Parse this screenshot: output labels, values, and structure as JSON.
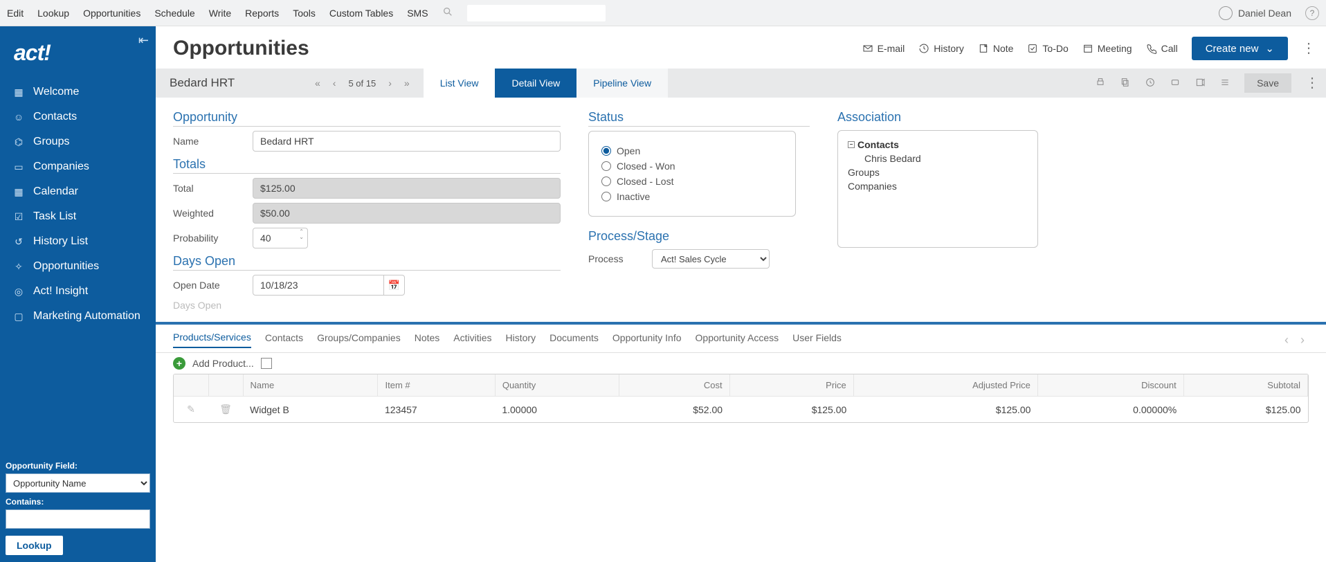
{
  "topmenu": {
    "items": [
      "Edit",
      "Lookup",
      "Opportunities",
      "Schedule",
      "Write",
      "Reports",
      "Tools",
      "Custom Tables",
      "SMS"
    ]
  },
  "user": {
    "name": "Daniel Dean"
  },
  "logo": "act!",
  "sidebar": {
    "items": [
      {
        "label": "Welcome",
        "icon": "grid"
      },
      {
        "label": "Contacts",
        "icon": "person"
      },
      {
        "label": "Groups",
        "icon": "people"
      },
      {
        "label": "Companies",
        "icon": "briefcase"
      },
      {
        "label": "Calendar",
        "icon": "calendar"
      },
      {
        "label": "Task List",
        "icon": "check"
      },
      {
        "label": "History List",
        "icon": "history"
      },
      {
        "label": "Opportunities",
        "icon": "diamond"
      },
      {
        "label": "Act! Insight",
        "icon": "eye"
      },
      {
        "label": "Marketing Automation",
        "icon": "monitor"
      }
    ],
    "field_label": "Opportunity Field:",
    "field_value": "Opportunity Name",
    "contains_label": "Contains:",
    "contains_value": "",
    "lookup_btn": "Lookup"
  },
  "page": {
    "title": "Opportunities",
    "actions": [
      {
        "label": "E-mail",
        "icon": "mail"
      },
      {
        "label": "History",
        "icon": "history"
      },
      {
        "label": "Note",
        "icon": "note"
      },
      {
        "label": "To-Do",
        "icon": "check"
      },
      {
        "label": "Meeting",
        "icon": "calendar"
      },
      {
        "label": "Call",
        "icon": "phone"
      }
    ],
    "create_btn": "Create new"
  },
  "viewbar": {
    "record": "Bedard HRT",
    "counter": "5 of 15",
    "tabs": [
      {
        "label": "List View"
      },
      {
        "label": "Detail View",
        "active": true
      },
      {
        "label": "Pipeline View"
      }
    ],
    "save": "Save"
  },
  "detail": {
    "opportunity_title": "Opportunity",
    "name_label": "Name",
    "name_value": "Bedard HRT",
    "totals_title": "Totals",
    "total_label": "Total",
    "total_value": "$125.00",
    "weighted_label": "Weighted",
    "weighted_value": "$50.00",
    "prob_label": "Probability",
    "prob_value": "40",
    "days_title": "Days Open",
    "open_label": "Open Date",
    "open_value": "10/18/23",
    "daysopen_label": "Days Open",
    "status_title": "Status",
    "status_options": [
      "Open",
      "Closed - Won",
      "Closed - Lost",
      "Inactive"
    ],
    "status_selected": "Open",
    "process_title": "Process/Stage",
    "process_label": "Process",
    "process_value": "Act! Sales Cycle",
    "assoc_title": "Association",
    "assoc": {
      "contacts_label": "Contacts",
      "contact_name": "Chris Bedard",
      "groups_label": "Groups",
      "companies_label": "Companies"
    }
  },
  "bottom_tabs": [
    "Products/Services",
    "Contacts",
    "Groups/Companies",
    "Notes",
    "Activities",
    "History",
    "Documents",
    "Opportunity Info",
    "Opportunity Access",
    "User Fields"
  ],
  "bottom_active": 0,
  "products": {
    "add_label": "Add Product...",
    "columns": [
      "",
      "",
      "Name",
      "Item #",
      "Quantity",
      "Cost",
      "Price",
      "Adjusted Price",
      "Discount",
      "Subtotal"
    ],
    "rows": [
      {
        "name": "Widget B",
        "item": "123457",
        "qty": "1.00000",
        "cost": "$52.00",
        "price": "$125.00",
        "adj": "$125.00",
        "disc": "0.00000%",
        "sub": "$125.00"
      }
    ]
  }
}
